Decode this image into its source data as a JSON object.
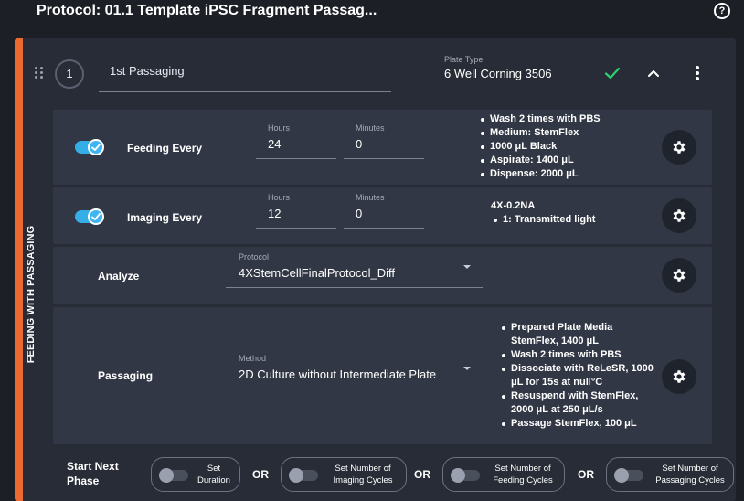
{
  "header": {
    "title": "Protocol: 01.1 Template iPSC Fragment Passag...",
    "help_icon": "?"
  },
  "phase": {
    "number": "1",
    "name": "1st Passaging",
    "plate_type_label": "Plate Type",
    "plate_type_value": "6 Well Corning 3506",
    "vertical_label": "FEEDING WITH PASSAGING",
    "accent_color": "#ec6a2f"
  },
  "feeding": {
    "label": "Feeding Every",
    "enabled": true,
    "hours_label": "Hours",
    "hours_value": "24",
    "minutes_label": "Minutes",
    "minutes_value": "0",
    "summary": [
      "Wash 2 times with PBS",
      "Medium: StemFlex",
      "1000 μL Black",
      "Aspirate: 1400 μL",
      "Dispense: 2000 μL"
    ]
  },
  "imaging": {
    "label": "Imaging Every",
    "enabled": true,
    "hours_label": "Hours",
    "hours_value": "12",
    "minutes_label": "Minutes",
    "minutes_value": "0",
    "summary_title": "4X-0.2NA",
    "summary": [
      "1: Transmitted light"
    ]
  },
  "analyze": {
    "label": "Analyze",
    "protocol_label": "Protocol",
    "protocol_value": "4XStemCellFinalProtocol_Diff"
  },
  "passaging": {
    "label": "Passaging",
    "method_label": "Method",
    "method_value": "2D Culture without Intermediate Plate",
    "summary": [
      "Prepared Plate Media StemFlex, 1400 μL",
      "Wash 2 times with PBS",
      "Dissociate with ReLeSR, 1000 μL for 15s at null°C",
      "Resuspend with StemFlex, 2000 μL at 250 μL/s",
      "Passage StemFlex, 100 μL"
    ]
  },
  "footer": {
    "start_next_phase_line1": "Start Next",
    "start_next_phase_line2": "Phase",
    "or_label": "OR",
    "options": [
      {
        "line1": "Set",
        "line2": "Duration"
      },
      {
        "line1": "Set Number of",
        "line2": "Imaging Cycles"
      },
      {
        "line1": "Set Number of",
        "line2": "Feeding Cycles"
      },
      {
        "line1": "Set Number of",
        "line2": "Passaging Cycles"
      }
    ]
  },
  "colors": {
    "background": "#1c1f26",
    "card": "#272c36",
    "row": "#313744",
    "toggle_on": "#35aee8",
    "check": "#2fd06f"
  }
}
